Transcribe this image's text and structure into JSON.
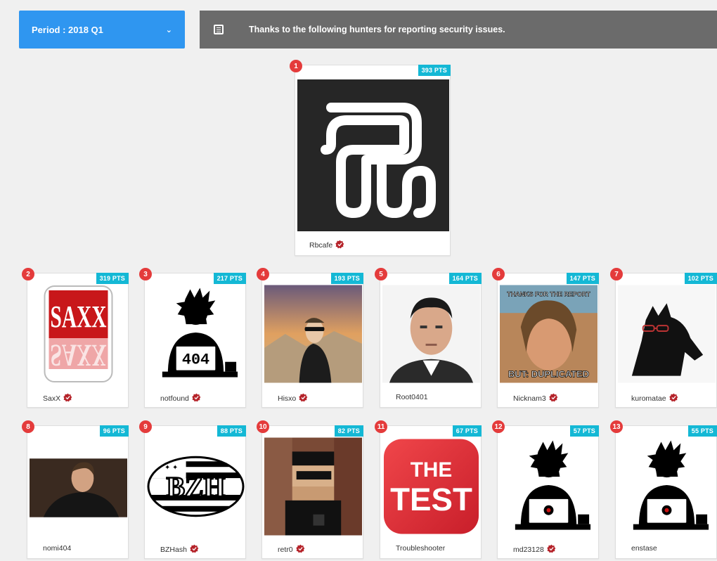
{
  "period": {
    "label": "Period : 2018 Q1"
  },
  "banner": {
    "text": "Thanks to the following hunters for reporting security issues."
  },
  "hunters": [
    {
      "rank": "1",
      "points": "393 PTS",
      "name": "Rbcafe",
      "avatar": "rb-logo",
      "verified": true
    },
    {
      "rank": "2",
      "points": "319 PTS",
      "name": "SaxX",
      "avatar": "saxx-logo",
      "verified": true
    },
    {
      "rank": "3",
      "points": "217 PTS",
      "name": "notfound",
      "avatar": "hacker-404-icon",
      "avatar_text": "404",
      "verified": true
    },
    {
      "rank": "4",
      "points": "193 PTS",
      "name": "Hisxo",
      "avatar": "photo-person-sunglasses",
      "verified": true
    },
    {
      "rank": "5",
      "points": "164 PTS",
      "name": "Root0401",
      "avatar": "photo-person-portrait",
      "verified": false
    },
    {
      "rank": "6",
      "points": "147 PTS",
      "name": "Nicknam3",
      "avatar": "meme-image",
      "avatar_text_top": "THANKS FOR THE REPORT",
      "avatar_text_bottom": "BUT: DUPLICATED",
      "verified": true
    },
    {
      "rank": "7",
      "points": "102 PTS",
      "name": "kuromatae",
      "avatar": "wolf-image",
      "verified": true
    },
    {
      "rank": "8",
      "points": "96 PTS",
      "name": "nomi404",
      "avatar": "photo-person-dark",
      "verified": false
    },
    {
      "rank": "9",
      "points": "88 PTS",
      "name": "BZHash",
      "avatar": "bzh-logo",
      "avatar_text": "BZH",
      "verified": true
    },
    {
      "rank": "10",
      "points": "82 PTS",
      "name": "retr0",
      "avatar": "pixel-character",
      "verified": true
    },
    {
      "rank": "11",
      "points": "67 PTS",
      "name": "Troubleshooter",
      "avatar": "the-test-logo",
      "avatar_text_top": "THE",
      "avatar_text_bottom": "TEST",
      "verified": false
    },
    {
      "rank": "12",
      "points": "57 PTS",
      "name": "md23128",
      "avatar": "hacker-icon",
      "verified": true
    },
    {
      "rank": "13",
      "points": "55 PTS",
      "name": "enstase",
      "avatar": "hacker-icon",
      "verified": false
    }
  ],
  "colors": {
    "accent": "#2f96f0",
    "points_badge": "#14b8d5",
    "rank_badge": "#e43b3b",
    "banner": "#6b6b6b",
    "verified": "#b5232a"
  }
}
